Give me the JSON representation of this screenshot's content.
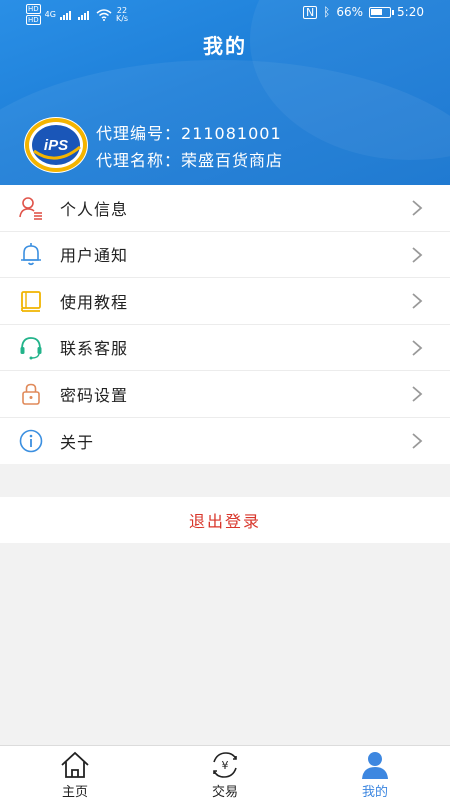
{
  "status_bar": {
    "hd_top": "HD",
    "hd_bottom": "HD",
    "net_type": "4G",
    "speed_value": "22",
    "speed_unit": "K/s",
    "battery_percent": "66%",
    "battery_level": 0.66,
    "time": "5:20"
  },
  "header": {
    "title": "我的"
  },
  "agent": {
    "logo_text": "iPS",
    "number_label": "代理编号：",
    "number_value": "211081001",
    "name_label": "代理名称：",
    "name_value": "荣盛百货商店"
  },
  "menu": {
    "items": [
      {
        "label": "个人信息",
        "icon": "user-profile-icon",
        "color": "#e0544a"
      },
      {
        "label": "用户通知",
        "icon": "bell-icon",
        "color": "#3b8fe0"
      },
      {
        "label": "使用教程",
        "icon": "tutorial-book-icon",
        "color": "#f0b400"
      },
      {
        "label": "联系客服",
        "icon": "headset-icon",
        "color": "#22b38a"
      },
      {
        "label": "密码设置",
        "icon": "lock-icon",
        "color": "#e08a5a"
      },
      {
        "label": "关于",
        "icon": "info-icon",
        "color": "#3b8fe0"
      }
    ]
  },
  "logout": {
    "label": "退出登录",
    "color": "#d8362b"
  },
  "tabbar": {
    "tabs": [
      {
        "label": "主页",
        "icon": "home-icon",
        "active": false
      },
      {
        "label": "交易",
        "icon": "yuan-exchange-icon",
        "active": false
      },
      {
        "label": "我的",
        "icon": "user-icon",
        "active": true
      }
    ],
    "active_color": "#3d87e0"
  }
}
